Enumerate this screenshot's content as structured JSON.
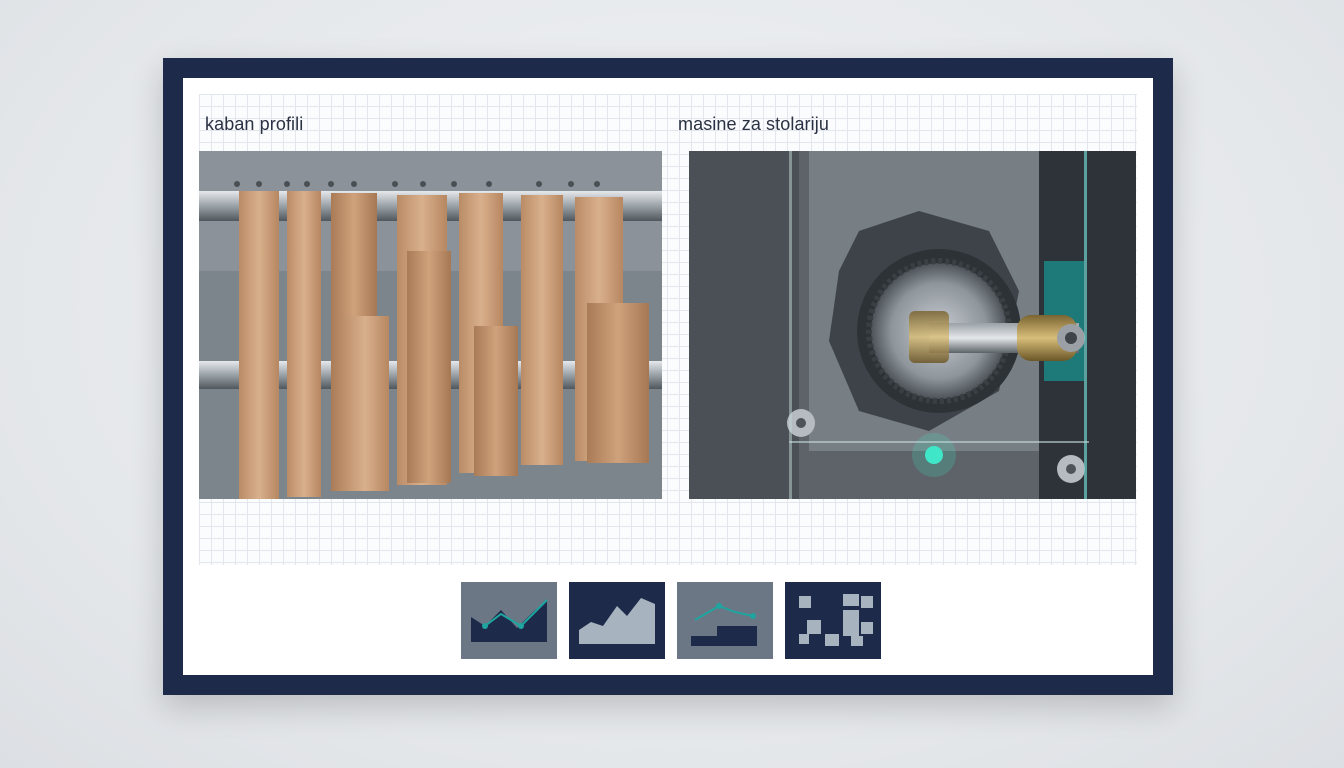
{
  "panels": {
    "left": {
      "title": "kaban profili"
    },
    "right": {
      "title": "masine za stolariju"
    }
  },
  "thumbnails": [
    {
      "icon": "mountain-area-chart-icon",
      "bg": "#6b7784",
      "fg": "#1d2a4a"
    },
    {
      "icon": "rising-area-chart-icon",
      "bg": "#1d2a4a",
      "fg": "#a8b3c0"
    },
    {
      "icon": "step-line-chart-icon",
      "bg": "#6b7784",
      "fg": "#1d2a4a"
    },
    {
      "icon": "checker-grid-icon",
      "bg": "#1d2a4a",
      "fg": "#a8b3c0"
    }
  ],
  "colors": {
    "frame": "#1d2a4a",
    "accent": "#1fa5a0"
  }
}
